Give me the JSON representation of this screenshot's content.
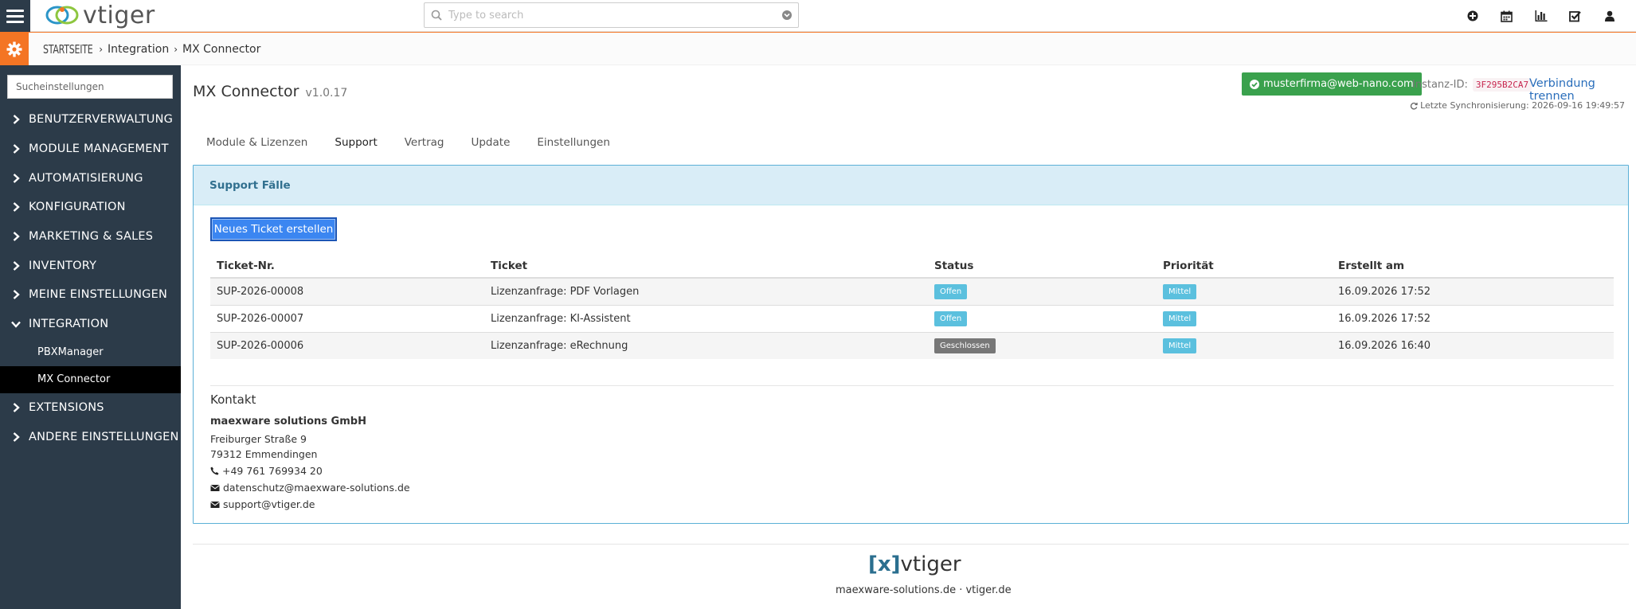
{
  "app": {
    "logo_text": "vtiger"
  },
  "search": {
    "placeholder": "Type to search"
  },
  "breadcrumb": {
    "home": "STARTSEITE",
    "level1": "Integration",
    "level2": "MX Connector"
  },
  "sidebar": {
    "search_placeholder": "Sucheinstellungen",
    "items": [
      {
        "label": "BENUTZERVERWALTUNG"
      },
      {
        "label": "MODULE MANAGEMENT"
      },
      {
        "label": "AUTOMATISIERUNG"
      },
      {
        "label": "KONFIGURATION"
      },
      {
        "label": "MARKETING & SALES"
      },
      {
        "label": "INVENTORY"
      },
      {
        "label": "MEINE EINSTELLUNGEN"
      },
      {
        "label": "INTEGRATION"
      }
    ],
    "sub_items": [
      {
        "label": "PBXManager"
      },
      {
        "label": "MX Connector"
      }
    ],
    "items_after": [
      {
        "label": "EXTENSIONS"
      },
      {
        "label": "ANDERE EINSTELLUNGEN"
      }
    ]
  },
  "header": {
    "title": "MX Connector",
    "version": "v1.0.17",
    "account_email": "musterfirma@web-nano.com",
    "instance_label": "Instanz-ID:",
    "instance_id": "3F295B2CA7",
    "disconnect_label": "Verbindung trennen",
    "sync_text": "Letzte Synchronisierung: 2026-09-16 19:49:57"
  },
  "tabs": [
    {
      "label": "Module & Lizenzen"
    },
    {
      "label": "Support"
    },
    {
      "label": "Vertrag"
    },
    {
      "label": "Update"
    },
    {
      "label": "Einstellungen"
    }
  ],
  "support": {
    "panel_title": "Support Fälle",
    "new_ticket_label": "Neues Ticket erstellen",
    "columns": [
      "Ticket-Nr.",
      "Ticket",
      "Status",
      "Priorität",
      "Erstellt am"
    ],
    "rows": [
      {
        "nr": "SUP-2026-00008",
        "ticket": "Lizenzanfrage: PDF Vorlagen",
        "status": "Offen",
        "priority": "Mittel",
        "created": "16.09.2026 17:52"
      },
      {
        "nr": "SUP-2026-00007",
        "ticket": "Lizenzanfrage: KI-Assistent",
        "status": "Offen",
        "priority": "Mittel",
        "created": "16.09.2026 17:52"
      },
      {
        "nr": "SUP-2026-00006",
        "ticket": "Lizenzanfrage: eRechnung",
        "status": "Geschlossen",
        "priority": "Mittel",
        "created": "16.09.2026 16:40"
      }
    ]
  },
  "contact": {
    "heading": "Kontakt",
    "company": "maexware solutions GmbH",
    "street": "Freiburger Straße 9",
    "city": "79312 Emmendingen",
    "phone": "+49 761 769934 20",
    "email1": "datenschutz@maexware-solutions.de",
    "email2": "support@vtiger.de"
  },
  "footer": {
    "logo_bracket": "[x]",
    "logo_text": "vtiger",
    "links": "maexware-solutions.de · vtiger.de"
  },
  "colors": {
    "accent": "#f47524",
    "sidebar": "#2c3b49",
    "primary": "#3b86f1",
    "success": "#3aa14d",
    "info": "#5bc0de"
  }
}
